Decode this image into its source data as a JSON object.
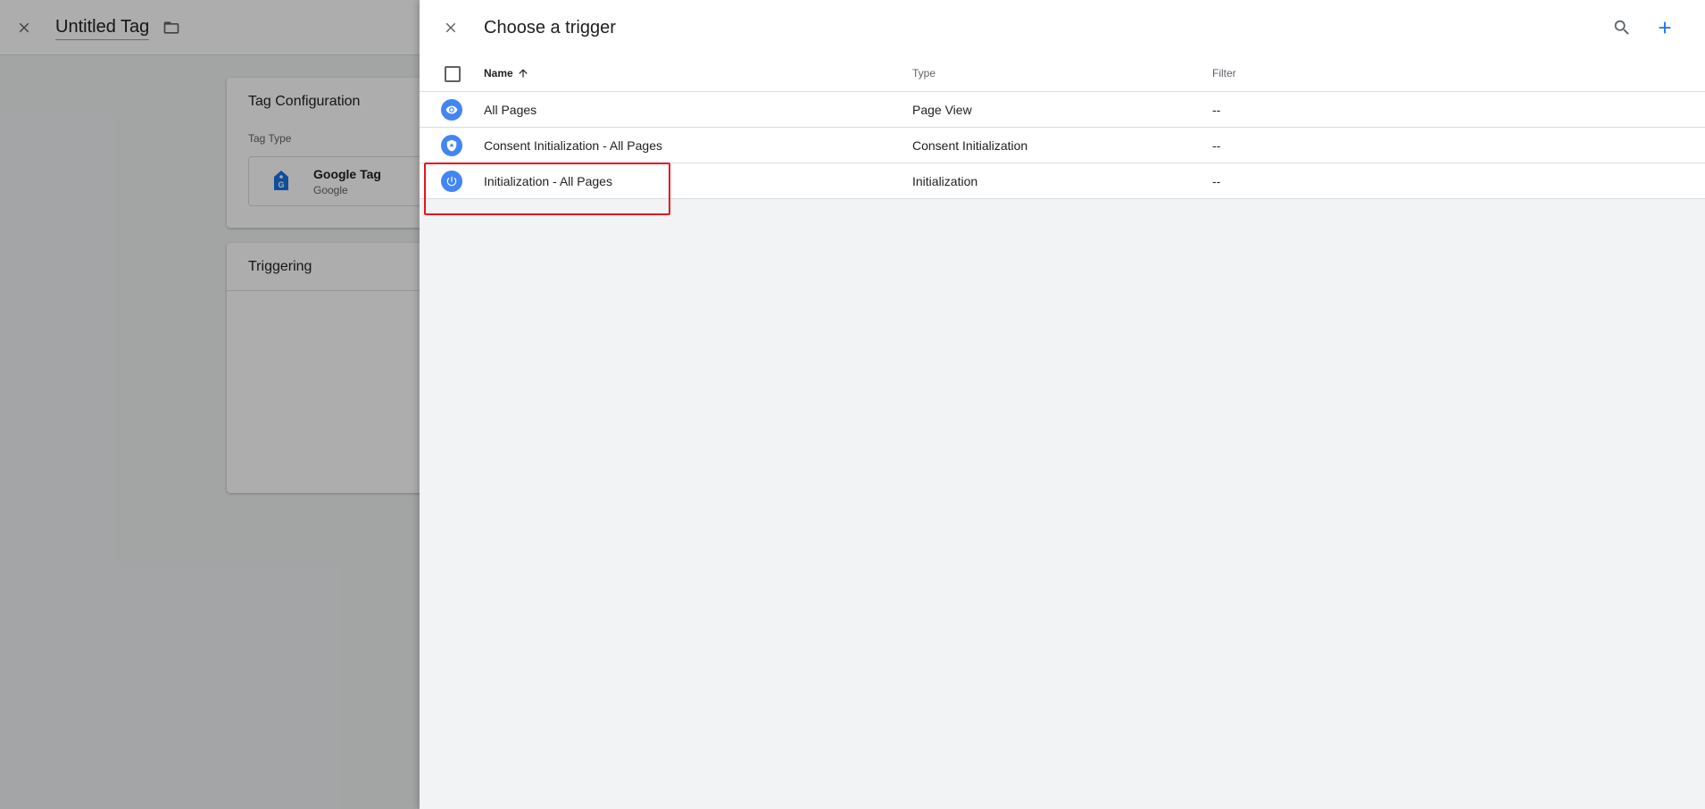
{
  "editor": {
    "title": "Untitled Tag",
    "close_icon": "close-icon",
    "folder_icon": "folder-icon",
    "config_card": {
      "title": "Tag Configuration",
      "tag_type_label": "Tag Type",
      "tag_type_name": "Google Tag",
      "tag_type_sub": "Google",
      "tag_type_icon": "google-tag-icon"
    },
    "trigger_card": {
      "title": "Triggering"
    }
  },
  "panel": {
    "title": "Choose a trigger",
    "close_icon": "close-icon",
    "search_icon": "search-icon",
    "add_icon": "add-icon",
    "accent_color": "#1a73e8",
    "columns": {
      "name": "Name",
      "type": "Type",
      "filter": "Filter"
    },
    "rows": [
      {
        "icon": "eye-icon",
        "name": "All Pages",
        "type": "Page View",
        "filter": "--"
      },
      {
        "icon": "shield-icon",
        "name": "Consent Initialization - All Pages",
        "type": "Consent Initialization",
        "filter": "--"
      },
      {
        "icon": "power-icon",
        "name": "Initialization - All Pages",
        "type": "Initialization",
        "filter": "--"
      }
    ],
    "highlight_color": "#e8141c"
  }
}
